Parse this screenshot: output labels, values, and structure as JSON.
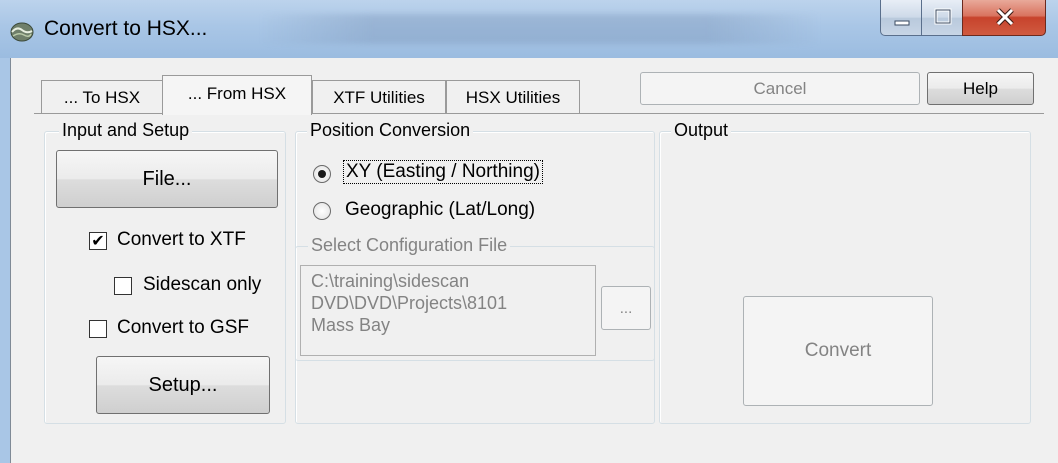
{
  "window": {
    "title": "Convert to HSX..."
  },
  "tabs": [
    {
      "label": "... To HSX",
      "selected": false
    },
    {
      "label": "... From HSX",
      "selected": true
    },
    {
      "label": "XTF Utilities",
      "selected": false
    },
    {
      "label": "HSX Utilities",
      "selected": false
    }
  ],
  "toolbar": {
    "cancel_label": "Cancel",
    "cancel_enabled": false,
    "help_label": "Help"
  },
  "input_setup": {
    "group_label": "Input and Setup",
    "file_button": "File...",
    "convert_xtf_label": "Convert to XTF",
    "convert_xtf_checked": true,
    "sidescan_only_label": "Sidescan only",
    "sidescan_only_checked": false,
    "convert_gsf_label": "Convert to GSF",
    "convert_gsf_checked": false,
    "setup_button": "Setup..."
  },
  "position": {
    "group_label": "Position Conversion",
    "options": [
      {
        "label": "XY (Easting / Northing)",
        "selected": true
      },
      {
        "label": "Geographic (Lat/Long)",
        "selected": false
      }
    ],
    "config_label": "Select Configuration File",
    "config_path": "C:\\training\\sidescan\nDVD\\DVD\\Projects\\8101\nMass Bay",
    "browse_label": "..."
  },
  "output": {
    "group_label": "Output",
    "convert_button": "Convert",
    "convert_enabled": false
  },
  "icons": {
    "app": "app-icon",
    "minimize": "minimize-icon",
    "maximize": "maximize-icon",
    "close": "close-icon"
  },
  "colors": {
    "titlebar": "#a9c6e6",
    "close_button": "#c7432c",
    "disabled_text": "#838383"
  }
}
